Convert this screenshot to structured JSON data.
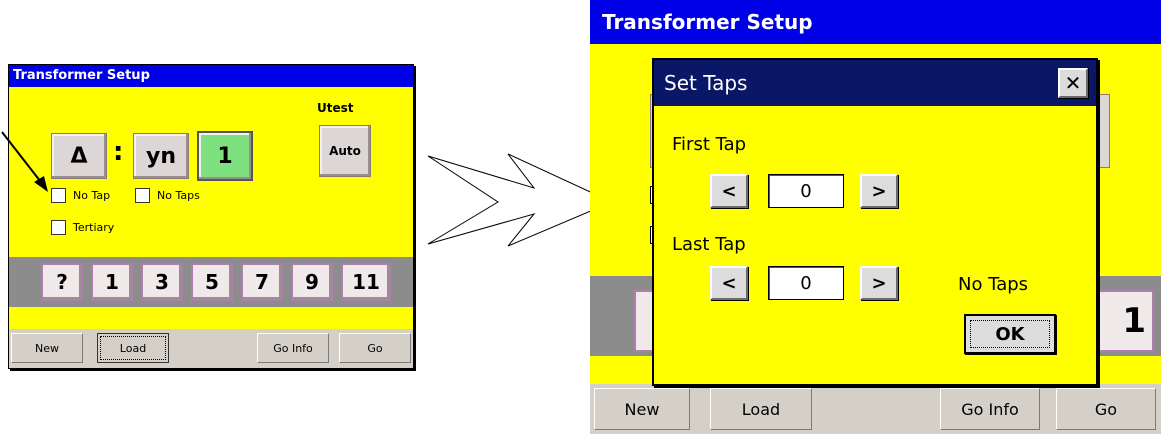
{
  "small_window": {
    "title": "Transformer Setup",
    "utest_label": "Utest",
    "auto_label": "Auto",
    "vector": {
      "hv": "Δ",
      "sep": ":",
      "lv": "yn",
      "clock": "1"
    },
    "checkboxes": {
      "no_tap": "No Tap",
      "no_taps": "No Taps",
      "tertiary": "Tertiary"
    },
    "numbers": [
      "?",
      "1",
      "3",
      "5",
      "7",
      "9",
      "11"
    ],
    "buttons": {
      "new": "New",
      "load": "Load",
      "go_info": "Go Info",
      "go": "Go"
    }
  },
  "big_window": {
    "title": "Transformer Setup",
    "partial_digit": "1",
    "buttons": {
      "new": "New",
      "load": "Load",
      "go_info": "Go Info",
      "go": "Go"
    }
  },
  "dialog": {
    "title": "Set Taps",
    "close": "✕",
    "first_tap_label": "First Tap",
    "last_tap_label": "Last Tap",
    "first_tap_value": "0",
    "last_tap_value": "0",
    "dec": "<",
    "inc": ">",
    "status": "No Taps",
    "ok": "OK"
  },
  "colors": {
    "window_bg": "#ffff00",
    "title_bar": "#0000e6",
    "dialog_title": "#0a1666",
    "clock_highlight": "#7ee07e"
  }
}
